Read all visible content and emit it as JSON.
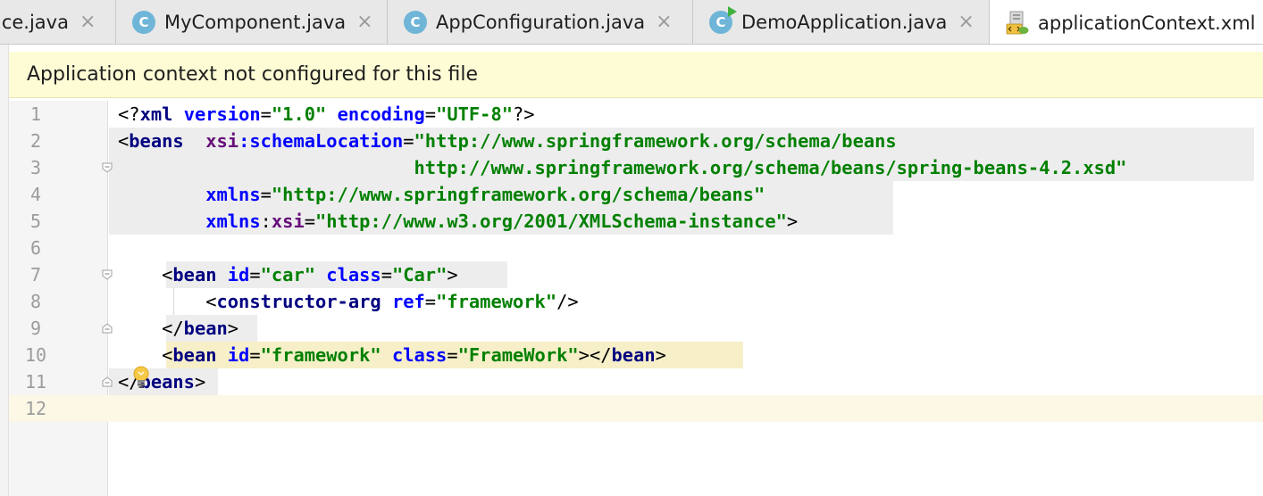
{
  "tabs": [
    {
      "label": "ice.java",
      "icon": "none",
      "close": "×"
    },
    {
      "label": "MyComponent.java",
      "icon": "class-icon",
      "icon_letter": "C",
      "close": "×"
    },
    {
      "label": "AppConfiguration.java",
      "icon": "class-icon",
      "icon_letter": "C",
      "close": "×"
    },
    {
      "label": "DemoApplication.java",
      "icon": "class-run-icon",
      "icon_letter": "C",
      "close": "×"
    },
    {
      "label": "applicationContext.xml",
      "icon": "xml-spring-icon",
      "active": true
    }
  ],
  "banner": {
    "text": "Application context not configured for this file"
  },
  "colors": {
    "tag": "#000080",
    "attr": "#0000ff",
    "ns": "#660e7a",
    "value": "#008000",
    "banner_bg": "#fdfcd5",
    "caret_line": "#fdf8e6",
    "block_highlight": "#ededed",
    "usage_highlight": "#f6efc8"
  },
  "editor": {
    "lines": [
      {
        "n": "1",
        "t": [
          {
            "c": "p",
            "v": "<?"
          },
          {
            "c": "tg",
            "v": "xml"
          },
          {
            "c": "p",
            "v": " "
          },
          {
            "c": "a",
            "v": "version"
          },
          {
            "c": "p",
            "v": "="
          },
          {
            "c": "s",
            "v": "\"1.0\""
          },
          {
            "c": "p",
            "v": " "
          },
          {
            "c": "a",
            "v": "encoding"
          },
          {
            "c": "p",
            "v": "="
          },
          {
            "c": "s",
            "v": "\"UTF-8\""
          },
          {
            "c": "p",
            "v": "?>"
          }
        ]
      },
      {
        "n": "2",
        "t": [
          {
            "c": "p",
            "v": "<"
          },
          {
            "c": "tg",
            "v": "beans"
          },
          {
            "c": "p",
            "v": "  "
          },
          {
            "c": "ns",
            "v": "xsi"
          },
          {
            "c": "a",
            "v": ":schemaLocation"
          },
          {
            "c": "p",
            "v": "="
          },
          {
            "c": "s",
            "v": "\"http://www.springframework.org/schema/beans"
          }
        ]
      },
      {
        "n": "3",
        "t": [
          {
            "c": "s",
            "v": "http://www.springframework.org/schema/beans/spring-beans-4.2.xsd\""
          }
        ]
      },
      {
        "n": "4",
        "t": [
          {
            "c": "a",
            "v": "xmlns"
          },
          {
            "c": "p",
            "v": "="
          },
          {
            "c": "s",
            "v": "\"http://www.springframework.org/schema/beans\""
          }
        ]
      },
      {
        "n": "5",
        "t": [
          {
            "c": "a",
            "v": "xmlns"
          },
          {
            "c": "p",
            "v": ":"
          },
          {
            "c": "ns",
            "v": "xsi"
          },
          {
            "c": "p",
            "v": "="
          },
          {
            "c": "s",
            "v": "\"http://www.w3.org/2001/XMLSchema-instance\""
          },
          {
            "c": "p",
            "v": ">"
          }
        ]
      },
      {
        "n": "6",
        "t": []
      },
      {
        "n": "7",
        "t": [
          {
            "c": "p",
            "v": "<"
          },
          {
            "c": "tg",
            "v": "bean"
          },
          {
            "c": "p",
            "v": " "
          },
          {
            "c": "a",
            "v": "id"
          },
          {
            "c": "p",
            "v": "="
          },
          {
            "c": "s",
            "v": "\"car\""
          },
          {
            "c": "p",
            "v": " "
          },
          {
            "c": "a",
            "v": "class"
          },
          {
            "c": "p",
            "v": "="
          },
          {
            "c": "s",
            "v": "\"Car\""
          },
          {
            "c": "p",
            "v": ">"
          }
        ]
      },
      {
        "n": "8",
        "t": [
          {
            "c": "p",
            "v": "<"
          },
          {
            "c": "tg",
            "v": "constructor-arg"
          },
          {
            "c": "p",
            "v": " "
          },
          {
            "c": "a",
            "v": "ref"
          },
          {
            "c": "p",
            "v": "="
          },
          {
            "c": "s",
            "v": "\"framework\""
          },
          {
            "c": "p",
            "v": "/>"
          }
        ]
      },
      {
        "n": "9",
        "t": [
          {
            "c": "p",
            "v": "</"
          },
          {
            "c": "tg",
            "v": "bean"
          },
          {
            "c": "p",
            "v": ">"
          }
        ]
      },
      {
        "n": "10",
        "t": [
          {
            "c": "p",
            "v": "<"
          },
          {
            "c": "tg",
            "v": "bean"
          },
          {
            "c": "p",
            "v": " "
          },
          {
            "c": "a",
            "v": "id"
          },
          {
            "c": "p",
            "v": "="
          },
          {
            "c": "s",
            "v": "\"framework\""
          },
          {
            "c": "p",
            "v": " "
          },
          {
            "c": "a",
            "v": "class"
          },
          {
            "c": "p",
            "v": "="
          },
          {
            "c": "s",
            "v": "\"FrameWork\""
          },
          {
            "c": "p",
            "v": "></"
          },
          {
            "c": "tg",
            "v": "bean"
          },
          {
            "c": "p",
            "v": ">"
          }
        ]
      },
      {
        "n": "11",
        "t": [
          {
            "c": "p",
            "v": "</"
          },
          {
            "c": "tg",
            "v": "beans"
          },
          {
            "c": "p",
            "v": ">"
          }
        ]
      },
      {
        "n": "12",
        "t": []
      }
    ]
  }
}
